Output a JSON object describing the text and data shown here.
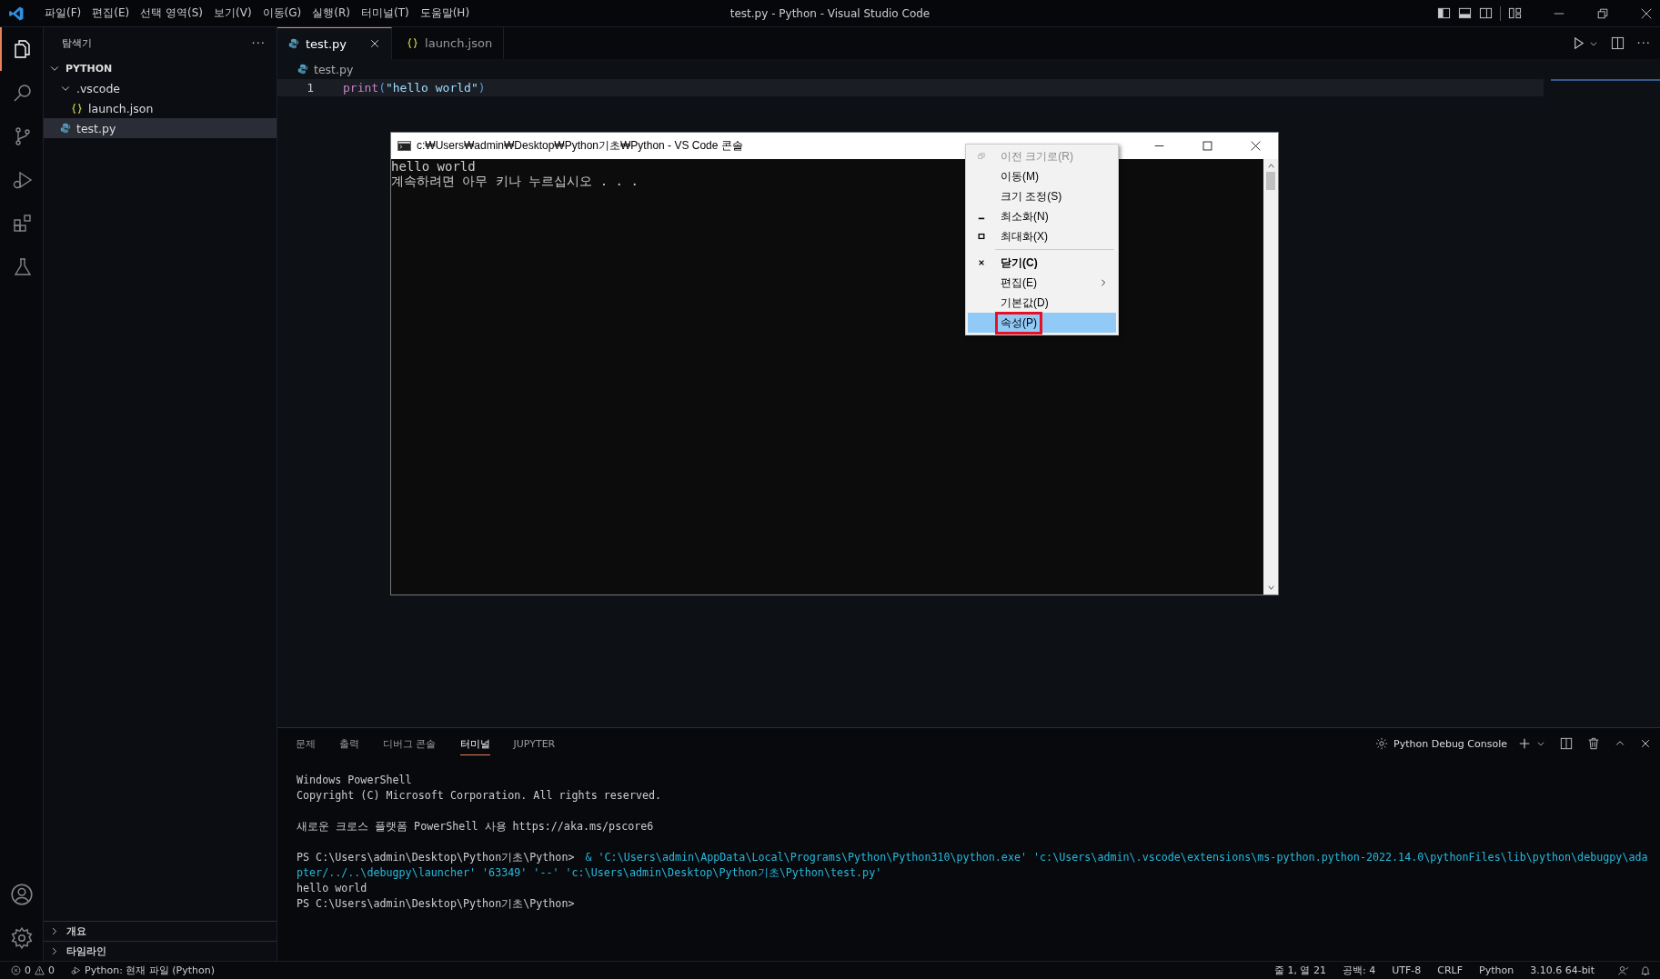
{
  "menu_bar": [
    "파일(F)",
    "편집(E)",
    "선택 영역(S)",
    "보기(V)",
    "이동(G)",
    "실행(R)",
    "터미널(T)",
    "도움말(H)"
  ],
  "window": {
    "title": "test.py - Python - Visual Studio Code"
  },
  "activity_bar": [
    {
      "kind": "files",
      "selected": true
    },
    {
      "kind": "search",
      "selected": false
    },
    {
      "kind": "branch",
      "selected": false
    },
    {
      "kind": "debug",
      "selected": false
    },
    {
      "kind": "extensions",
      "selected": false
    },
    {
      "kind": "flask",
      "selected": false
    }
  ],
  "sidebar": {
    "title": "탐색기",
    "more": "···",
    "tree": [
      {
        "label": "PYTHON",
        "kind": "folder",
        "expanded": true,
        "selected": false,
        "children": [
          {
            "label": ".vscode",
            "kind": "folder",
            "expanded": true,
            "selected": false,
            "children": [
              {
                "label": "launch.json",
                "kind": "json",
                "selected": false
              }
            ]
          },
          {
            "label": "test.py",
            "kind": "python",
            "selected": true
          }
        ]
      }
    ],
    "sections": [
      {
        "label": "개요",
        "expanded": false
      },
      {
        "label": "타임라인",
        "expanded": false
      }
    ]
  },
  "editor_tabs": [
    {
      "label": "test.py",
      "kind": "python",
      "selected": true
    },
    {
      "label": "launch.json",
      "kind": "json",
      "selected": false
    }
  ],
  "breadcrumb": "test.py",
  "code_lines": [
    {
      "number": "1",
      "func": "print",
      "open": "(",
      "string": "\"hello world\"",
      "close": ")"
    }
  ],
  "console_window": {
    "title": "c:₩Users₩admin₩Desktop₩Python기초₩Python - VS Code 콘솔",
    "lines": [
      "hello world",
      "계속하려면 아무 키나 누르십시오 . . ."
    ],
    "menu": [
      {
        "label": "이전 크기로(R)",
        "kind": "restore",
        "disabled": true,
        "selected": false,
        "annotated": false
      },
      {
        "label": "이동(M)",
        "kind": "plain",
        "disabled": false,
        "selected": false,
        "annotated": false
      },
      {
        "label": "크기 조정(S)",
        "kind": "plain",
        "disabled": false,
        "selected": false,
        "annotated": false
      },
      {
        "label": "최소화(N)",
        "kind": "minimize",
        "disabled": false,
        "selected": false,
        "annotated": false
      },
      {
        "label": "최대화(X)",
        "kind": "maximize",
        "disabled": false,
        "selected": false,
        "annotated": false
      },
      {
        "kind": "separator"
      },
      {
        "label": "닫기(C)",
        "kind": "close",
        "disabled": false,
        "selected": false,
        "annotated": false
      },
      {
        "label": "편집(E)",
        "kind": "submenu",
        "disabled": false,
        "selected": false,
        "annotated": false
      },
      {
        "label": "기본값(D)",
        "kind": "plain",
        "disabled": false,
        "selected": false,
        "annotated": false
      },
      {
        "label": "속성(P)",
        "kind": "plain",
        "disabled": false,
        "selected": true,
        "annotated": true
      }
    ]
  },
  "panel": {
    "tabs": [
      {
        "label": "문제",
        "selected": false
      },
      {
        "label": "출력",
        "selected": false
      },
      {
        "label": "디버그 콘솔",
        "selected": false
      },
      {
        "label": "터미널",
        "selected": true
      },
      {
        "label": "JUPYTER",
        "selected": false
      }
    ],
    "terminal_name": "Python Debug Console",
    "terminal_lines": [
      {
        "kind": "plain",
        "text": "Windows PowerShell"
      },
      {
        "kind": "plain",
        "text": "Copyright (C) Microsoft Corporation. All rights reserved."
      },
      {
        "kind": "blank"
      },
      {
        "kind": "plain",
        "text": "새로운 크로스 플랫폼 PowerShell 사용 https://aka.ms/pscore6"
      },
      {
        "kind": "blank"
      },
      {
        "kind": "command",
        "prompt": "PS C:\\Users\\admin\\Desktop\\Python기초\\Python>",
        "text": "& 'C:\\Users\\admin\\AppData\\Local\\Programs\\Python\\Python310\\python.exe' 'c:\\Users\\admin\\.vscode\\extensions\\ms-python.python-2022.14.0\\pythonFiles\\lib\\python\\debugpy\\ada"
      },
      {
        "kind": "continuation",
        "text": "pter/../..\\debugpy\\launcher' '63349' '--' 'c:\\Users\\admin\\Desktop\\Python기초\\Python\\test.py'"
      },
      {
        "kind": "plain",
        "text": "hello world"
      },
      {
        "kind": "prompt",
        "text": "PS C:\\Users\\admin\\Desktop\\Python기초\\Python>"
      }
    ]
  },
  "status_bar": {
    "errors": "0",
    "warnings": "0",
    "debug_target": "Python: 현재 파일 (Python)",
    "right": [
      "줄 1, 열 21",
      "공백: 4",
      "UTF-8",
      "CRLF",
      "Python",
      "3.10.6 64-bit"
    ]
  }
}
